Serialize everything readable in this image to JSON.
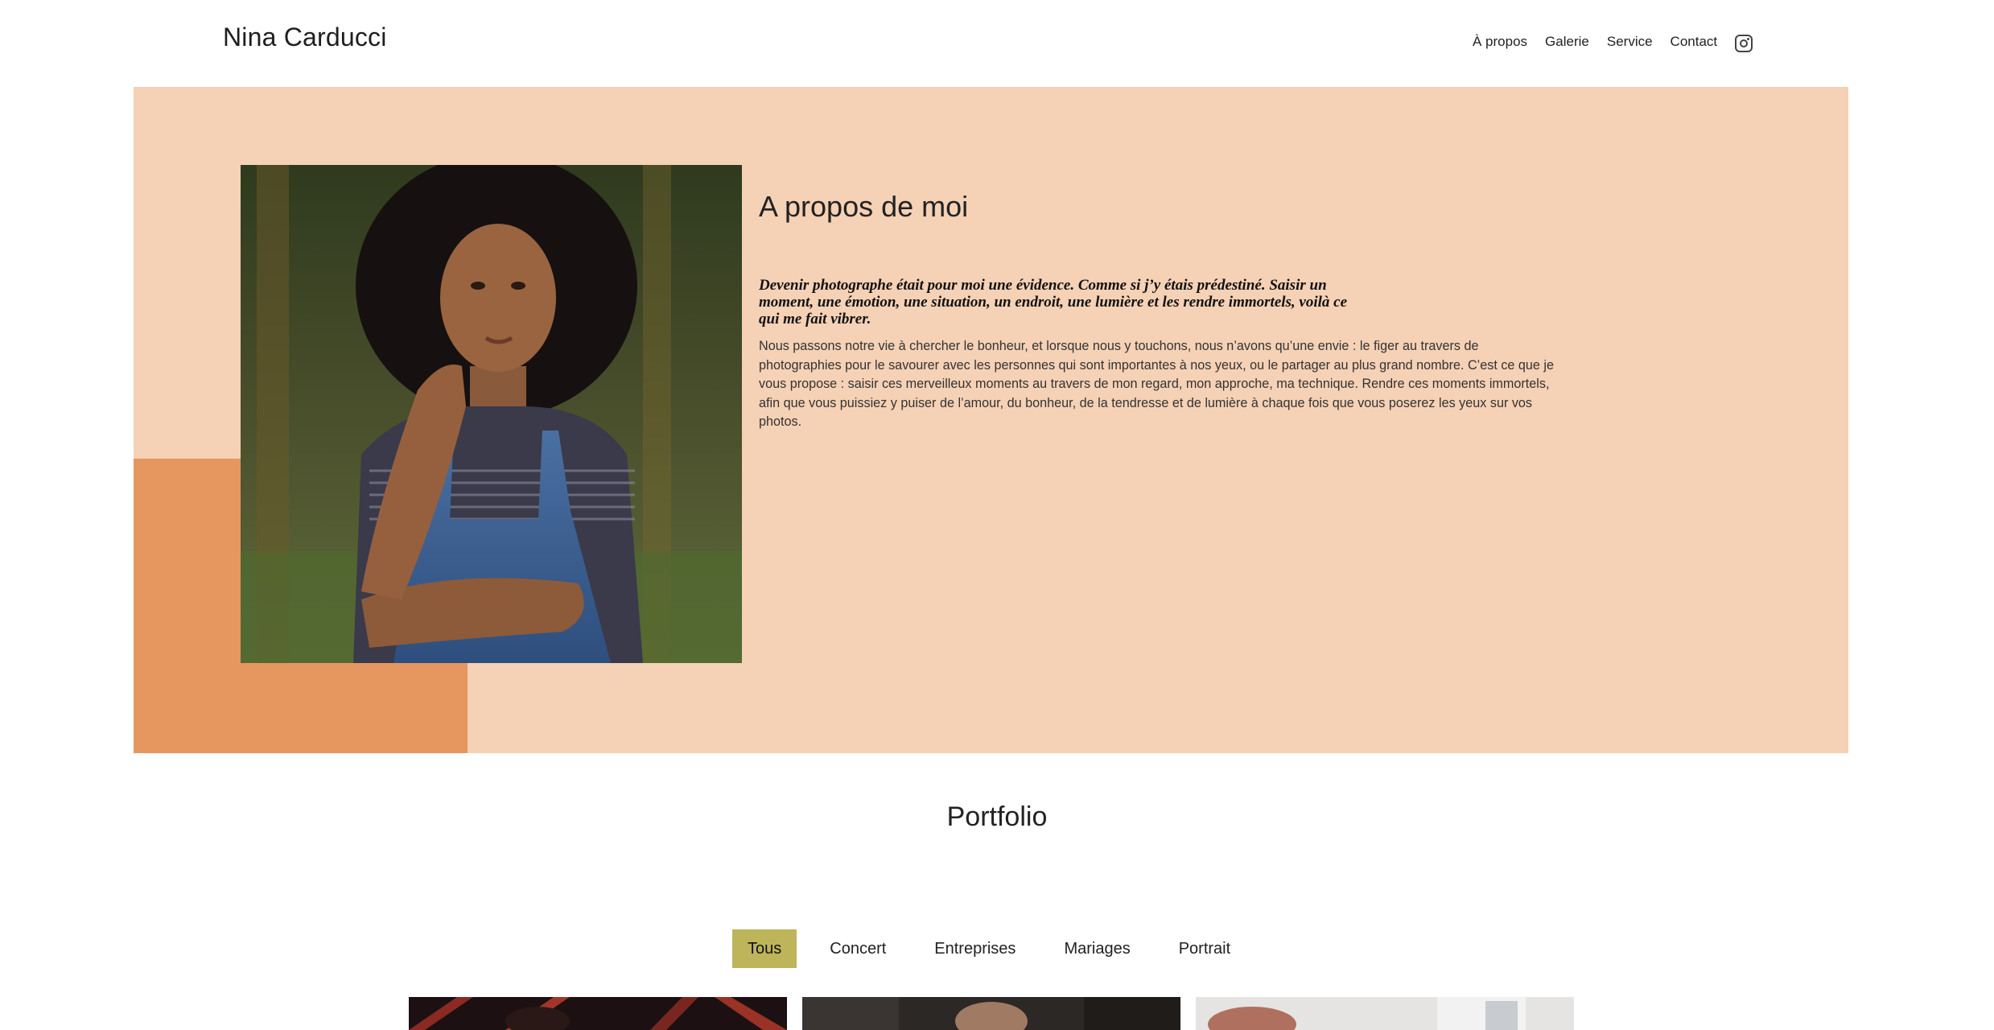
{
  "header": {
    "site_title": "Nina Carducci",
    "nav": [
      "À propos",
      "Galerie",
      "Service",
      "Contact"
    ],
    "social_icon": "instagram-icon"
  },
  "about": {
    "title": "A propos de moi",
    "quote": "Devenir photographe était pour moi une évidence. Comme si j’y étais prédestiné. Saisir un moment, une émotion, une situation, un endroit, une lumière et les rendre immortels, voilà ce qui me fait vibrer.",
    "body": "Nous passons notre vie à chercher le bonheur, et lorsque nous y touchons, nous n’avons qu’une envie : le figer au travers de photographies pour le savourer avec les personnes qui sont importantes à nos yeux, ou le partager au plus grand nombre. C’est ce que je vous propose : saisir ces merveilleux moments au travers de mon regard, mon approche, ma technique. Rendre ces moments immortels, afin que vous puissiez y puiser de l’amour, du bonheur, de la tendresse et de lumière à chaque fois que vous poserez les yeux sur vos photos."
  },
  "portfolio": {
    "title": "Portfolio",
    "filters": [
      "Tous",
      "Concert",
      "Entreprises",
      "Mariages",
      "Portrait"
    ],
    "active_filter": "Tous"
  },
  "colors": {
    "about_bg": "#f5d1b5",
    "accent": "#e5975f",
    "active_filter": "#beb45a"
  }
}
